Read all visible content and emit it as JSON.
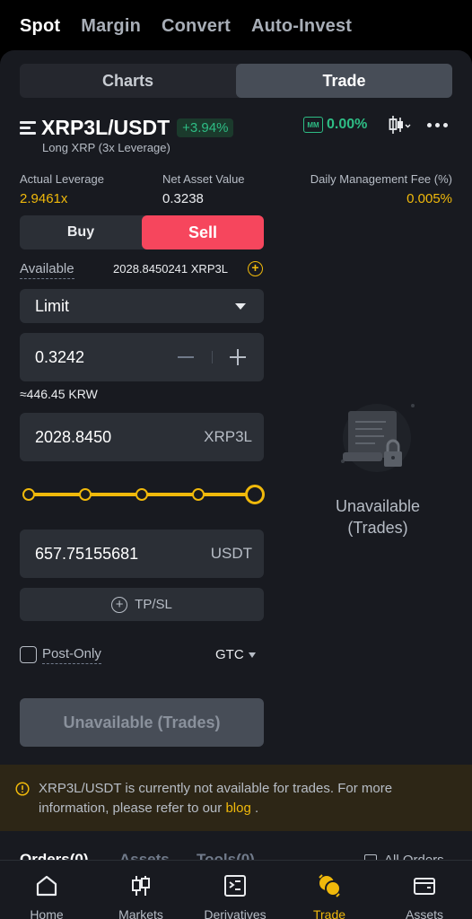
{
  "top_tabs": [
    "Spot",
    "Margin",
    "Convert",
    "Auto-Invest"
  ],
  "view_toggle": {
    "charts": "Charts",
    "trade": "Trade"
  },
  "pair": {
    "symbol": "XRP3L/USDT",
    "change": "+3.94%",
    "subtitle": "Long XRP (3x Leverage)",
    "mm_label": "MM",
    "mm_value": "0.00%"
  },
  "metrics": {
    "actual_leverage_label": "Actual Leverage",
    "actual_leverage_value": "2.9461x",
    "nav_label": "Net Asset Value",
    "nav_value": "0.3238",
    "fee_label": "Daily Management Fee (%)",
    "fee_value": "0.005%"
  },
  "side": {
    "buy": "Buy",
    "sell": "Sell"
  },
  "available": {
    "label": "Available",
    "value": "2028.8450241 XRP3L"
  },
  "order_type": "Limit",
  "price": {
    "value": "0.3242",
    "approx": "≈446.45 KRW"
  },
  "quantity": {
    "value": "2028.8450",
    "unit": "XRP3L"
  },
  "slider": {
    "percent": 100
  },
  "total": {
    "value": "657.75155681",
    "unit": "USDT"
  },
  "tpsl_label": "TP/SL",
  "post_only_label": "Post-Only",
  "time_in_force": "GTC",
  "submit_label": "Unavailable (Trades)",
  "unavailable_panel": {
    "line1": "Unavailable",
    "line2": "(Trades)"
  },
  "notice": {
    "text": "XRP3L/USDT is currently not available for trades. For more information, please refer to our",
    "link": "blog",
    "suffix": " ."
  },
  "order_tabs": [
    "Orders(0)",
    "Assets",
    "Tools(0)",
    "All Orders"
  ],
  "bottom_nav": [
    "Home",
    "Markets",
    "Derivatives",
    "Trade",
    "Assets"
  ],
  "colors": {
    "accent": "#F0B90B",
    "sell": "#F6465D",
    "up": "#2EBD85"
  }
}
